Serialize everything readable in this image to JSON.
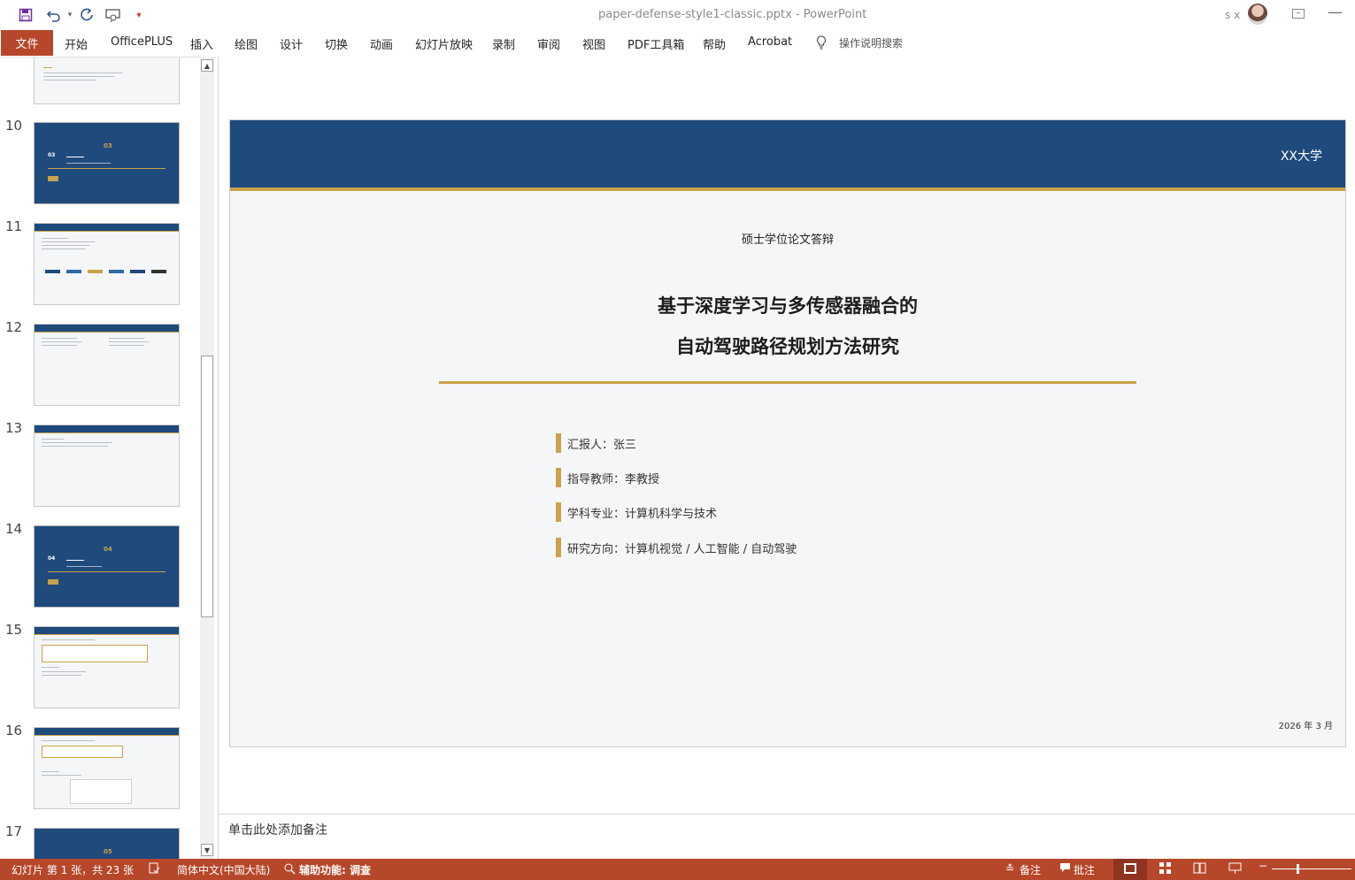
{
  "titlebar": {
    "document_title": "paper-defense-style1-classic.pptx  -  PowerPoint",
    "user_name": "s x",
    "qat": [
      "save-icon",
      "undo-icon",
      "redo-icon",
      "present-from-start-icon",
      "customize-icon"
    ]
  },
  "ribbon": {
    "file_tab": "文件",
    "tabs": [
      "开始",
      "OfficePLUS",
      "插入",
      "绘图",
      "设计",
      "切换",
      "动画",
      "幻灯片放映",
      "录制",
      "审阅",
      "视图",
      "PDF工具箱",
      "帮助",
      "Acrobat"
    ],
    "tell_me": "操作说明搜索"
  },
  "thumbnails": [
    {
      "number": "10",
      "kind": "section",
      "section_no": "03"
    },
    {
      "number": "11",
      "kind": "content"
    },
    {
      "number": "12",
      "kind": "content"
    },
    {
      "number": "13",
      "kind": "content"
    },
    {
      "number": "14",
      "kind": "section",
      "section_no": "04"
    },
    {
      "number": "15",
      "kind": "table"
    },
    {
      "number": "16",
      "kind": "table"
    },
    {
      "number": "17",
      "kind": "section",
      "section_no": "05"
    }
  ],
  "slide": {
    "university": "XX大学",
    "subtitle": "硕士学位论文答辩",
    "title_line1": "基于深度学习与多传感器融合的",
    "title_line2": "自动驾驶路径规划方法研究",
    "info": [
      "汇报人：张三",
      "指导教师：李教授",
      "学科专业：计算机科学与技术",
      "研究方向：计算机视觉 / 人工智能 / 自动驾驶"
    ],
    "date": "2026 年 3 月",
    "colors": {
      "header": "#1f4a7c",
      "accent": "#c9a24a",
      "background": "#f5f6f8"
    }
  },
  "notes_placeholder": "单击此处添加备注",
  "statusbar": {
    "slide_info": "幻灯片 第 1 张，共 23 张",
    "language": "简体中文(中国大陆)",
    "accessibility": "辅助功能: 调查",
    "notes_button": "备注",
    "comments_button": "批注"
  }
}
